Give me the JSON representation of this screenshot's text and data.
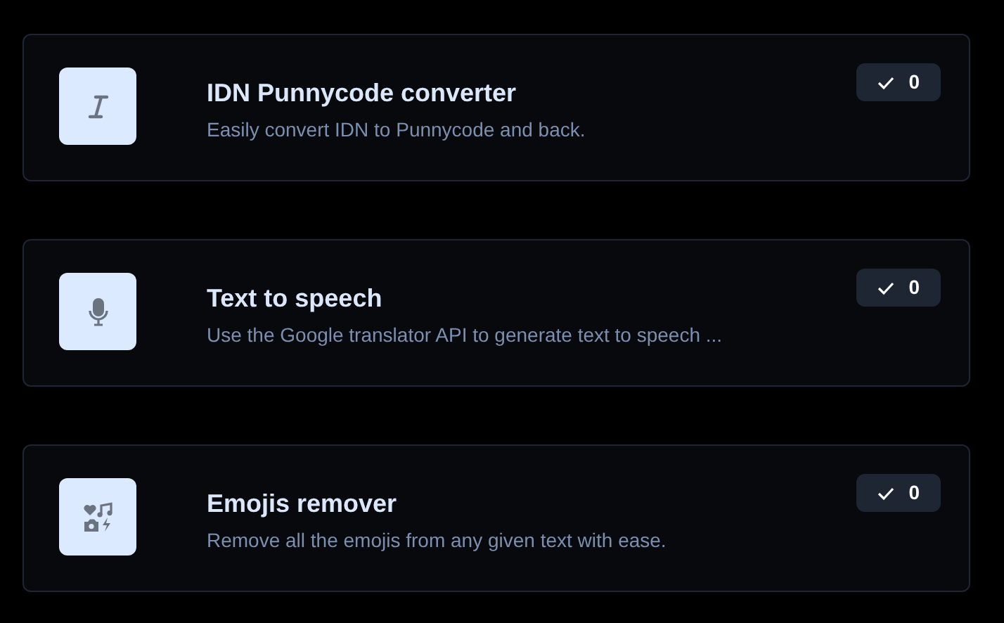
{
  "tools": [
    {
      "kind": "italic",
      "title": "IDN Punnycode converter",
      "description": "Easily convert IDN to Punnycode and back.",
      "count": "0"
    },
    {
      "kind": "mic",
      "title": "Text to speech",
      "description": "Use the Google translator API to generate text to speech ...",
      "count": "0"
    },
    {
      "kind": "media",
      "title": "Emojis remover",
      "description": "Remove all the emojis from any given text with ease.",
      "count": "0"
    }
  ]
}
